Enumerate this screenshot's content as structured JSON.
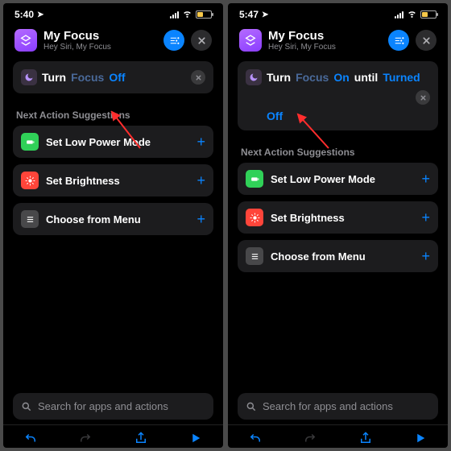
{
  "left": {
    "status": {
      "time": "5:40",
      "battery_pct": 40
    },
    "header": {
      "title": "My Focus",
      "subtitle": "Hey Siri, My Focus"
    },
    "action": {
      "tokens": [
        "Turn",
        "Focus",
        "Off"
      ],
      "token_styles": [
        "white",
        "dim",
        "blue"
      ]
    },
    "section_label": "Next Action Suggestions",
    "suggestions": [
      {
        "label": "Set Low Power Mode",
        "icon": "battery",
        "color": "green"
      },
      {
        "label": "Set Brightness",
        "icon": "sun",
        "color": "red"
      },
      {
        "label": "Choose from Menu",
        "icon": "menu",
        "color": "gray"
      }
    ],
    "search_placeholder": "Search for apps and actions"
  },
  "right": {
    "status": {
      "time": "5:47",
      "battery_pct": 40
    },
    "header": {
      "title": "My Focus",
      "subtitle": "Hey Siri, My Focus"
    },
    "action": {
      "tokens": [
        "Turn",
        "Focus",
        "On",
        "until",
        "Turned",
        "Off"
      ],
      "token_styles": [
        "white",
        "dim",
        "blue",
        "white",
        "blue",
        "blue"
      ]
    },
    "section_label": "Next Action Suggestions",
    "suggestions": [
      {
        "label": "Set Low Power Mode",
        "icon": "battery",
        "color": "green"
      },
      {
        "label": "Set Brightness",
        "icon": "sun",
        "color": "red"
      },
      {
        "label": "Choose from Menu",
        "icon": "menu",
        "color": "gray"
      }
    ],
    "search_placeholder": "Search for apps and actions"
  }
}
